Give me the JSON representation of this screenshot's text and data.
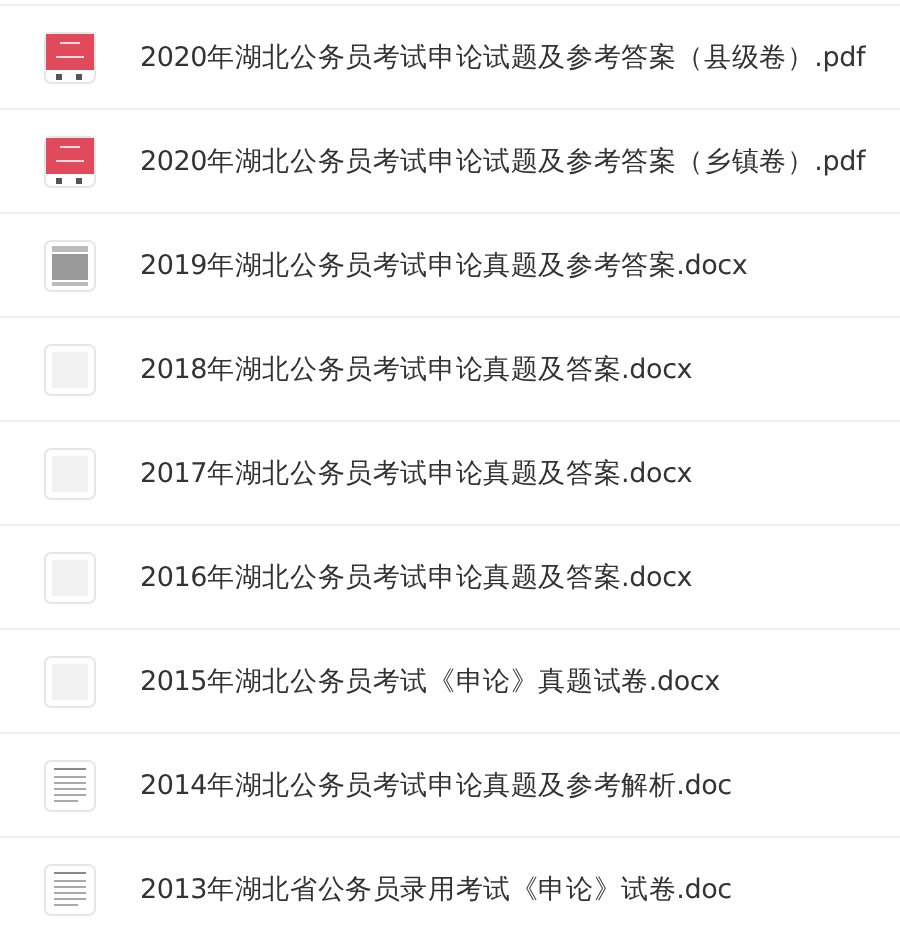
{
  "files": [
    {
      "name": "2020年湖北公务员考试申论试题及参考答案（县级卷）.pdf",
      "thumbnail": {
        "kind": "cover"
      }
    },
    {
      "name": "2020年湖北公务员考试申论试题及参考答案（乡镇卷）.pdf",
      "thumbnail": {
        "kind": "cover"
      }
    },
    {
      "name": "2019年湖北公务员考试申论真题及参考答案.docx",
      "thumbnail": {
        "kind": "dense"
      }
    },
    {
      "name": "2018年湖北公务员考试申论真题及答案.docx",
      "thumbnail": {
        "kind": "faint"
      }
    },
    {
      "name": "2017年湖北公务员考试申论真题及答案.docx",
      "thumbnail": {
        "kind": "faint"
      }
    },
    {
      "name": "2016年湖北公务员考试申论真题及答案.docx",
      "thumbnail": {
        "kind": "faint"
      }
    },
    {
      "name": "2015年湖北公务员考试《申论》真题试卷.docx",
      "thumbnail": {
        "kind": "faint"
      }
    },
    {
      "name": "2014年湖北公务员考试申论真题及参考解析.doc",
      "thumbnail": {
        "kind": "text"
      }
    },
    {
      "name": "2013年湖北省公务员录用考试《申论》试卷.doc",
      "thumbnail": {
        "kind": "text"
      }
    }
  ]
}
